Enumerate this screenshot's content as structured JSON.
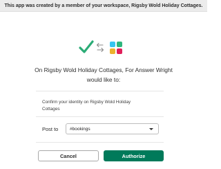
{
  "banner": {
    "text": "This app was created by a member of your workspace, Rigsby Wold Holiday Cottages."
  },
  "icons": {
    "left": "check-icon",
    "middle": "exchange-arrows-icon",
    "right": "slack-logo-icon"
  },
  "heading": {
    "text": "On Rigsby Wold Holiday Cottages, For Answer Wright would like to:"
  },
  "permission": {
    "text": "Confirm your identity on Rigsby Wold Holiday Cottages"
  },
  "post_to": {
    "label": "Post to",
    "selected": "#bookings"
  },
  "buttons": {
    "cancel": "Cancel",
    "authorize": "Authorize"
  },
  "colors": {
    "banner_bg": "#ececec",
    "authorize_bg": "#007a5a",
    "check_green": "#2bac76",
    "slack_blue": "#36c5f0",
    "slack_green": "#2eb67d",
    "slack_yellow": "#ecb22e",
    "slack_red": "#e01e5a"
  }
}
